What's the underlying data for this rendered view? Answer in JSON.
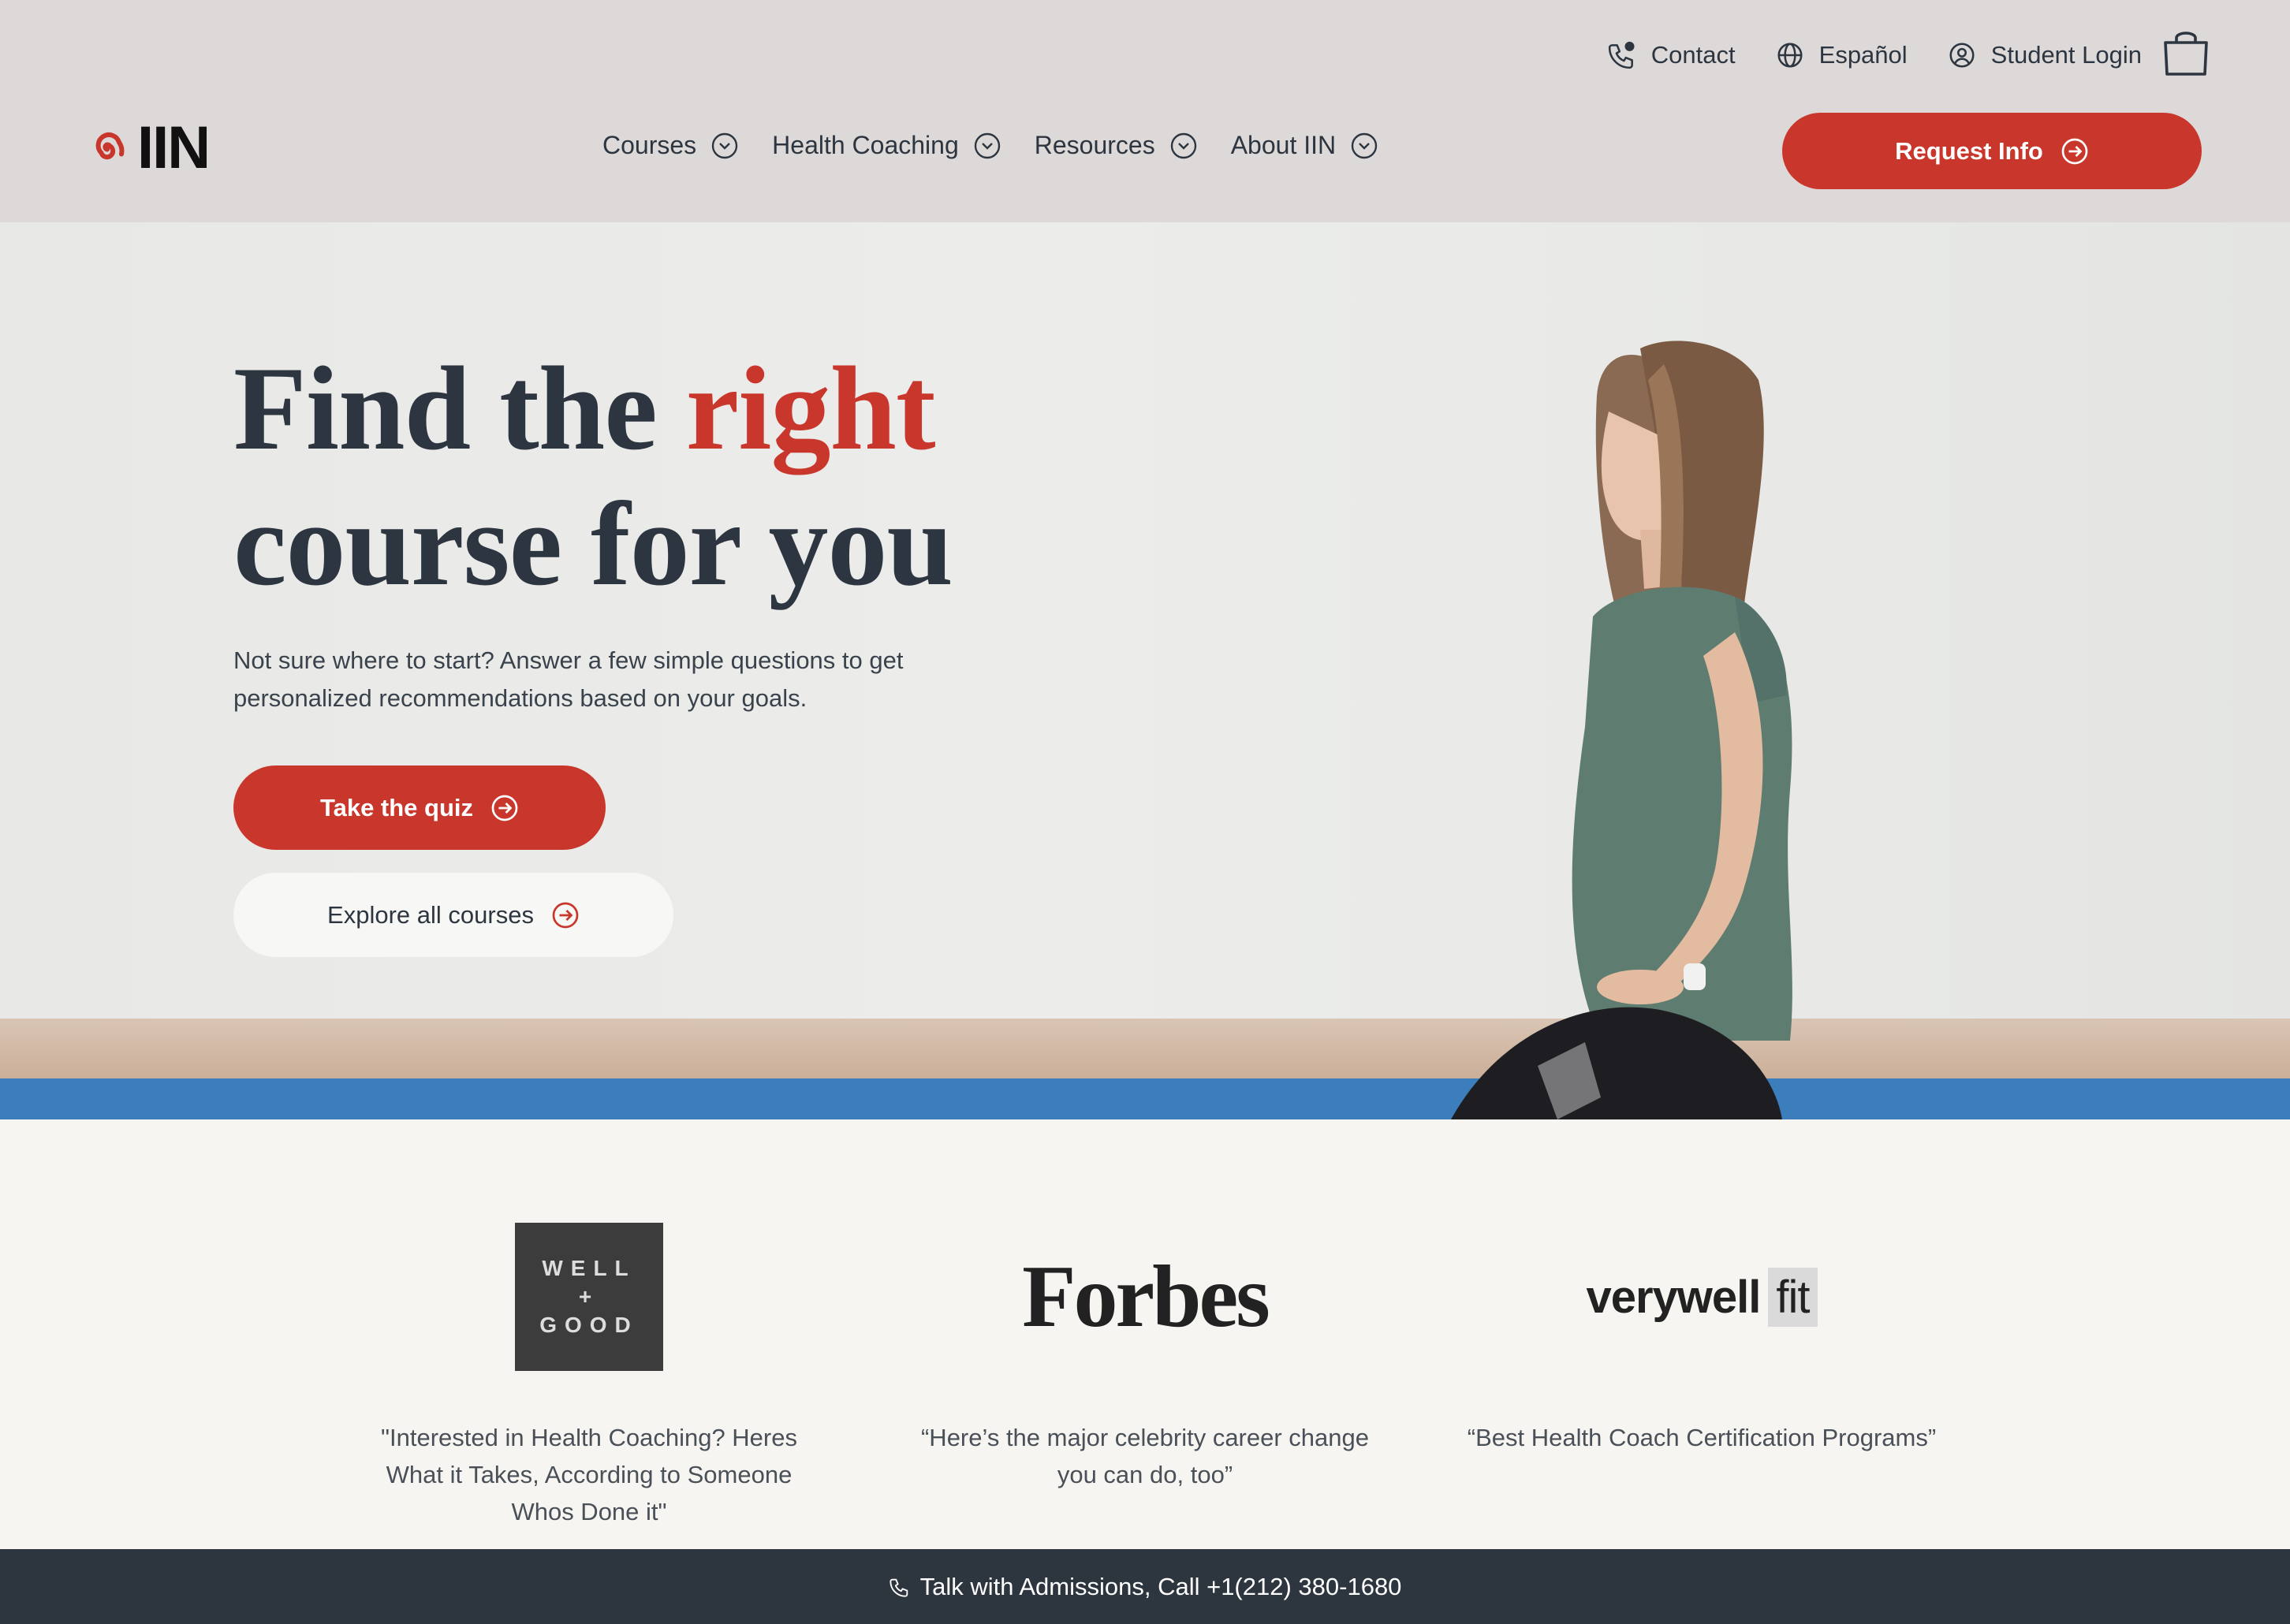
{
  "header": {
    "utility": [
      {
        "label": "Contact",
        "icon": "phone-icon"
      },
      {
        "label": "Español",
        "icon": "globe-icon"
      },
      {
        "label": "Student Login",
        "icon": "user-circle-icon"
      }
    ],
    "cart_icon": "shopping-bag-icon",
    "logo_text": "IIN",
    "nav": [
      {
        "label": "Courses",
        "icon": "chevron-down-icon"
      },
      {
        "label": "Health Coaching",
        "icon": "chevron-down-icon"
      },
      {
        "label": "Resources",
        "icon": "chevron-down-icon"
      },
      {
        "label": "About IIN",
        "icon": "chevron-down-icon"
      }
    ],
    "request_info_label": "Request Info"
  },
  "hero": {
    "title_part1": "Find the ",
    "title_accent": "right",
    "title_line2": "course for you",
    "subtitle": "Not sure where to start? Answer a few simple questions to get personalized recommendations based on your goals.",
    "quiz_button_label": "Take the quiz",
    "explore_button_label": "Explore all courses"
  },
  "press": [
    {
      "logo_lines": [
        "WELL",
        "+",
        "GOOD"
      ],
      "quote": "\"Interested in Health Coaching? Heres What it Takes, According to Someone Whos Done it\""
    },
    {
      "logo_text": "Forbes",
      "quote": "“Here’s the major celebrity career change you can do, too”"
    },
    {
      "logo_text": "verywell",
      "logo_suffix": "fit",
      "quote": "“Best Health Coach Certification Programs”"
    }
  ],
  "bottom_bar": {
    "text": "Talk with Admissions, Call +1(212) 380-1680"
  },
  "colors": {
    "accent": "#c9372c",
    "header_bg": "#dcd9d8",
    "dark": "#2d353e",
    "text": "#2d3640"
  }
}
